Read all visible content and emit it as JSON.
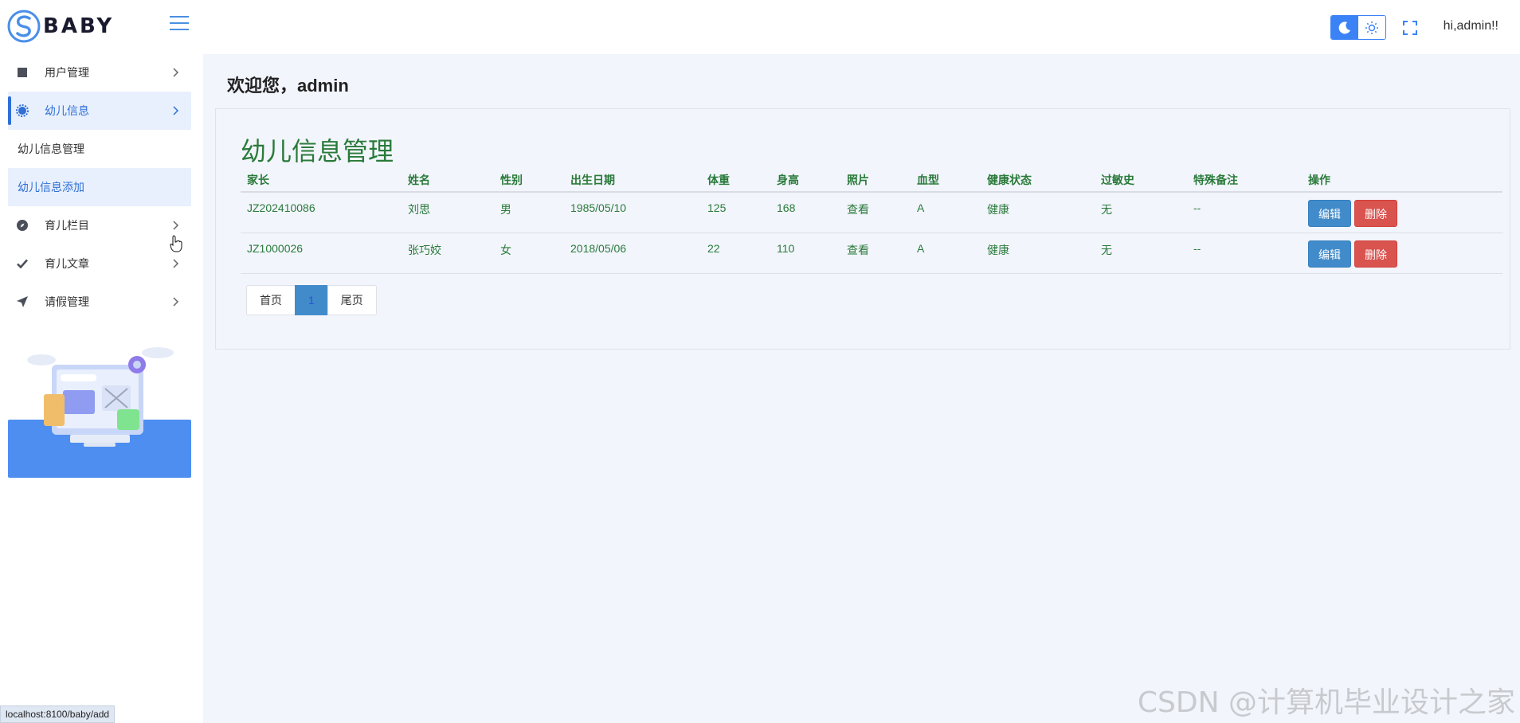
{
  "brand": {
    "logo_text": "BABY"
  },
  "topbar": {
    "greeting": "hi,admin!!"
  },
  "sidebar": {
    "items": [
      {
        "label": "用户管理",
        "icon": "square-icon"
      },
      {
        "label": "幼儿信息",
        "icon": "gear-icon"
      },
      {
        "label": "育儿栏目",
        "icon": "compass-icon"
      },
      {
        "label": "育儿文章",
        "icon": "check-icon"
      },
      {
        "label": "请假管理",
        "icon": "send-icon"
      }
    ],
    "submenu": [
      {
        "label": "幼儿信息管理"
      },
      {
        "label": "幼儿信息添加"
      }
    ]
  },
  "status_url": "localhost:8100/baby/add",
  "main": {
    "welcome": "欢迎您，admin",
    "card_title": "幼儿信息管理",
    "table": {
      "headers": [
        "家长",
        "姓名",
        "性别",
        "出生日期",
        "体重",
        "身高",
        "照片",
        "血型",
        "健康状态",
        "过敏史",
        "特殊备注",
        "操作"
      ],
      "rows": [
        {
          "parent": "JZ202410086",
          "name": "刘思",
          "gender": "男",
          "birth": "1985/05/10",
          "weight": "125",
          "height": "168",
          "photo": "查看",
          "blood": "A",
          "health": "健康",
          "allergy": "无",
          "note": "--"
        },
        {
          "parent": "JZ1000026",
          "name": "张巧姣",
          "gender": "女",
          "birth": "2018/05/06",
          "weight": "22",
          "height": "110",
          "photo": "查看",
          "blood": "A",
          "health": "健康",
          "allergy": "无",
          "note": "--"
        }
      ],
      "edit_label": "编辑",
      "delete_label": "删除"
    },
    "pager": {
      "first": "首页",
      "current": "1",
      "last": "尾页"
    }
  },
  "watermark": "CSDN @计算机毕业设计之家",
  "colors": {
    "accent": "#3b82f6",
    "title_green": "#2a7a3a",
    "edit": "#428bca",
    "delete": "#d9534f"
  }
}
